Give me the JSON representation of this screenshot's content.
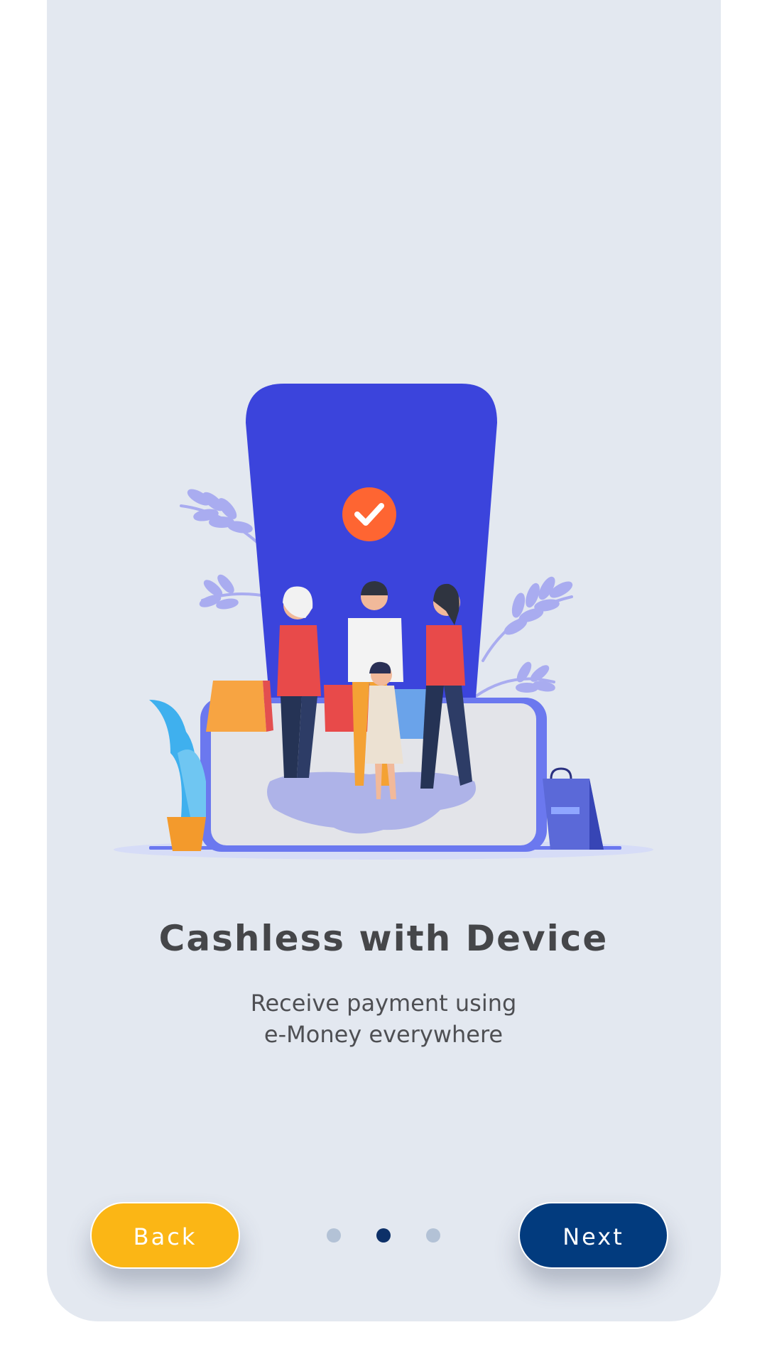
{
  "onboarding": {
    "title": "Cashless with Device",
    "subtitle_line1": "Receive payment using",
    "subtitle_line2": "e-Money everywhere",
    "illustration_icon": "check-icon",
    "page_indicator": {
      "current": 2,
      "total": 3
    }
  },
  "buttons": {
    "back_label": "Back",
    "next_label": "Next"
  },
  "colors": {
    "background": "#e3e8f0",
    "back_button": "#fbb615",
    "next_button": "#023b7e",
    "dot_active": "#0d3068",
    "dot_inactive": "#b3c2d6",
    "phone": "#3b44dc",
    "check_badge": "#fe6532"
  }
}
